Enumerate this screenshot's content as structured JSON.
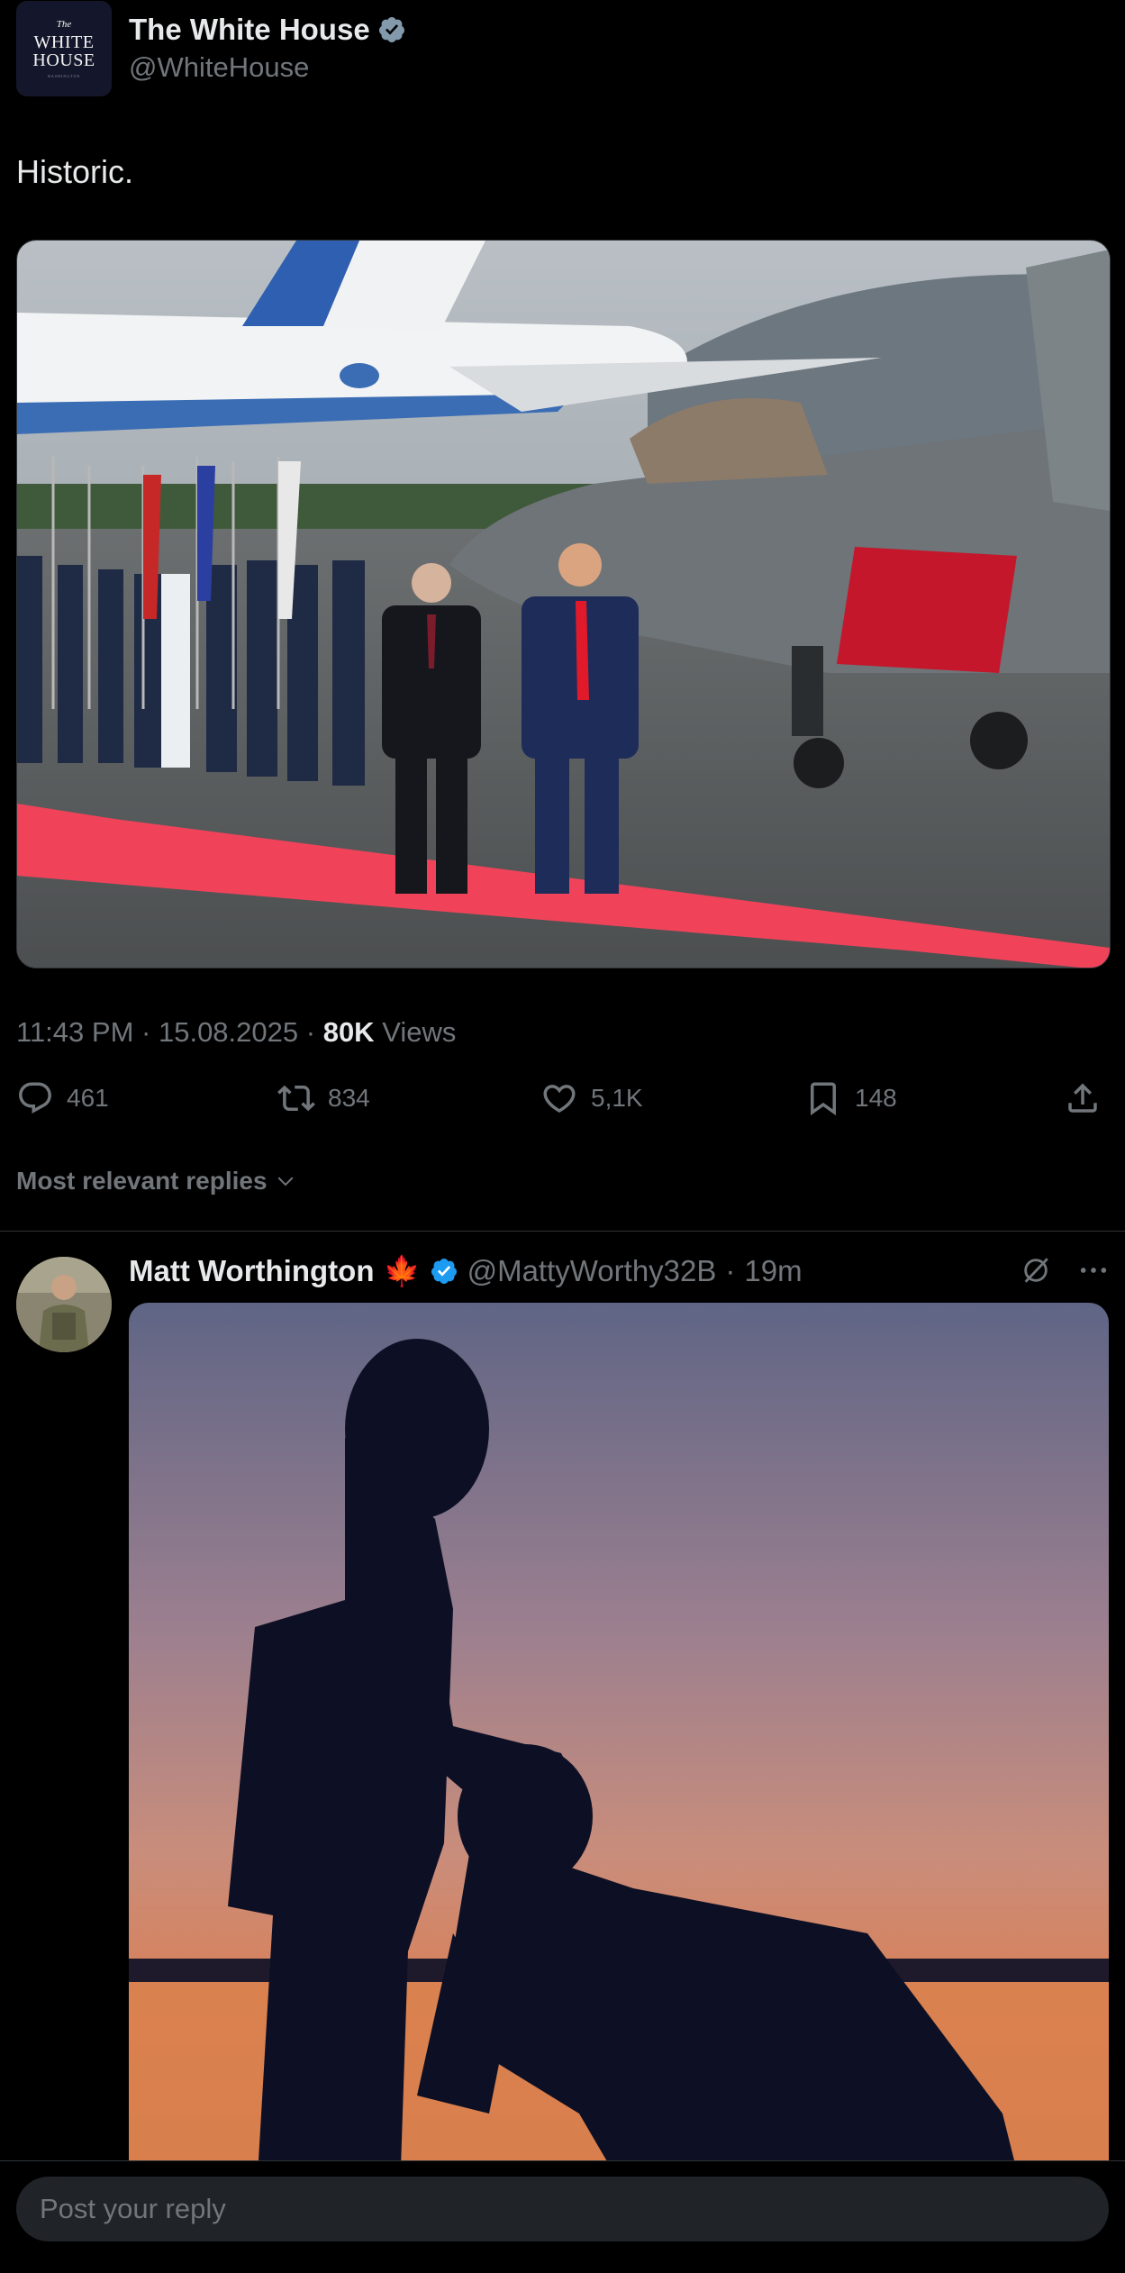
{
  "post": {
    "author": {
      "name": "The White House",
      "handle": "@WhiteHouse",
      "avatar_text": {
        "line1": "The",
        "line2": "WHITE",
        "line3": "HOUSE",
        "line4": "WASHINGTON"
      },
      "verified": "grey-checkmark-icon"
    },
    "text": "Historic.",
    "image_icon": "photo-icon",
    "time": "11:43 PM",
    "date": "15.08.2025",
    "separator": "·",
    "views_count": "80K",
    "views_label": "Views",
    "actions": {
      "replies": "461",
      "reposts": "834",
      "likes": "5,1K",
      "bookmarks": "148"
    }
  },
  "replies_filter": {
    "label": "Most relevant replies"
  },
  "reply": {
    "author": {
      "name": "Matt Worthington",
      "emoji": "🍁",
      "handle": "@MattyWorthy32B",
      "age": "19m"
    }
  },
  "composer": {
    "placeholder": "Post your reply"
  },
  "colors": {
    "accent": "#1d9bf0",
    "muted": "#71767b",
    "text": "#e7e9ea",
    "carpet": "#f0435a"
  }
}
